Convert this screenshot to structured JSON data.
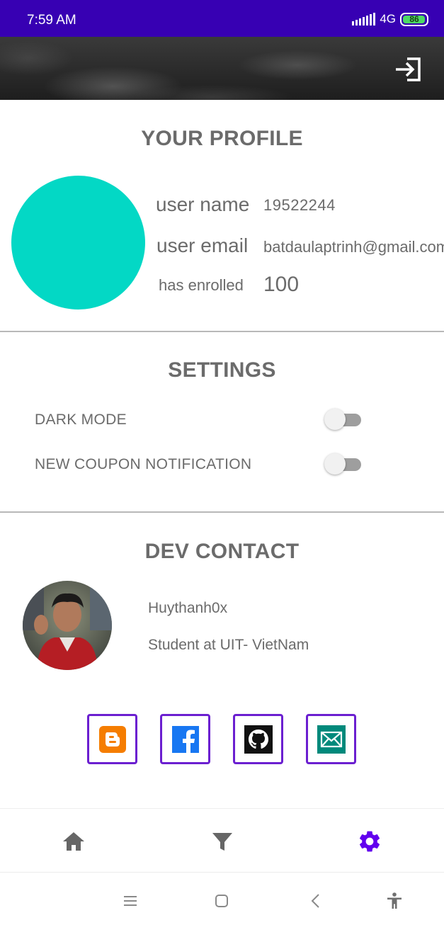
{
  "status_bar": {
    "time": "7:59 AM",
    "network": "4G",
    "battery": "86"
  },
  "profile": {
    "title": "YOUR PROFILE",
    "username_label": "user name",
    "username_value": "19522244",
    "email_label": "user email",
    "email_value": "batdaulaptrinh@gmail.com",
    "enrolled_label": "has enrolled",
    "enrolled_value": "100",
    "avatar_color": "#03d8c5"
  },
  "settings": {
    "title": "SETTINGS",
    "dark_mode_label": "DARK MODE",
    "dark_mode_enabled": false,
    "coupon_notification_label": "NEW COUPON NOTIFICATION",
    "coupon_notification_enabled": false
  },
  "dev_contact": {
    "title": "DEV CONTACT",
    "name": "Huythanh0x",
    "bio": "Student at UIT- VietNam",
    "links": [
      "blogger-icon",
      "facebook-icon",
      "github-icon",
      "email-icon"
    ]
  },
  "bottom_nav": {
    "items": [
      "home-icon",
      "filter-icon",
      "settings-icon"
    ],
    "active": "settings-icon"
  },
  "colors": {
    "status_bar": "#3700b3",
    "accent": "#6b1fd0",
    "active_nav": "#6200ee",
    "text": "#6b6b6b"
  }
}
